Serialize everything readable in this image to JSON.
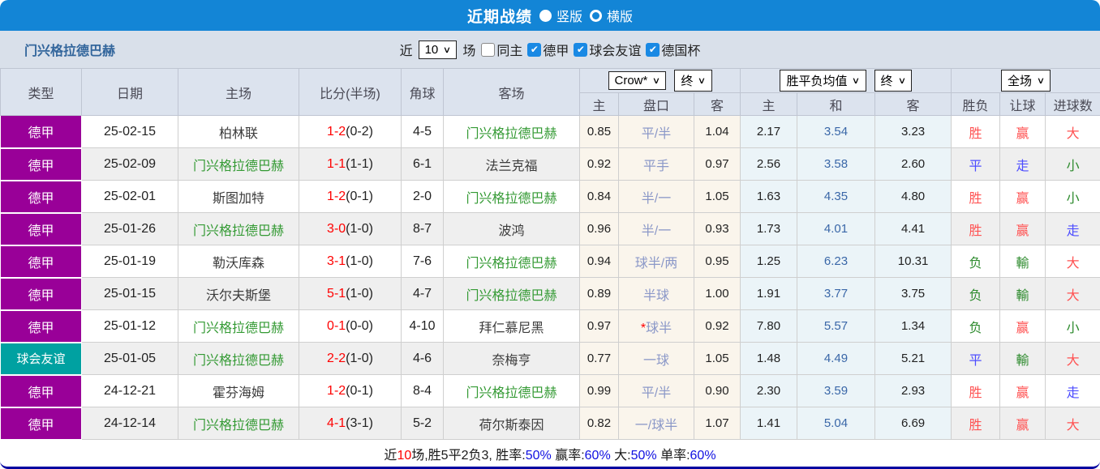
{
  "topbar": {
    "title": "近期战绩",
    "radio_vertical": "竖版",
    "radio_horizontal": "横版"
  },
  "filterbar": {
    "team": "门兴格拉德巴赫",
    "near_label": "近",
    "count_value": "10",
    "games_label": "场",
    "checkboxes": [
      {
        "label": "同主",
        "checked": false
      },
      {
        "label": "德甲",
        "checked": true
      },
      {
        "label": "球会友谊",
        "checked": true
      },
      {
        "label": "德国杯",
        "checked": true
      }
    ]
  },
  "table": {
    "headers_left": [
      "类型",
      "日期",
      "主场",
      "比分(半场)",
      "角球",
      "客场"
    ],
    "dropdowns": {
      "odds_source": "Crow*",
      "odds_time1": "终",
      "avg_type": "胜平负均值",
      "odds_time2": "终",
      "scope": "全场"
    },
    "subheaders": [
      "主",
      "盘口",
      "客",
      "主",
      "和",
      "客",
      "胜负",
      "让球",
      "进球数"
    ],
    "rows": [
      {
        "type": "德甲",
        "type_color": "purple",
        "date": "25-02-15",
        "home": "柏林联",
        "home_focus": false,
        "score": "1-2",
        "half": "(0-2)",
        "corner": "4-5",
        "away": "门兴格拉德巴赫",
        "away_focus": true,
        "odds_home": "0.85",
        "handicap_star": "",
        "handicap": "平/半",
        "odds_away": "1.04",
        "avg_home": "2.17",
        "avg_draw": "3.54",
        "avg_away": "3.23",
        "result": "胜",
        "result_color": "red",
        "handicap_result": "赢",
        "handicap_result_color": "red",
        "goals": "大",
        "goals_color": "red"
      },
      {
        "type": "德甲",
        "type_color": "purple",
        "date": "25-02-09",
        "home": "门兴格拉德巴赫",
        "home_focus": true,
        "score": "1-1",
        "half": "(1-1)",
        "corner": "6-1",
        "away": "法兰克福",
        "away_focus": false,
        "odds_home": "0.92",
        "handicap_star": "",
        "handicap": "平手",
        "odds_away": "0.97",
        "avg_home": "2.56",
        "avg_draw": "3.58",
        "avg_away": "2.60",
        "result": "平",
        "result_color": "blue",
        "handicap_result": "走",
        "handicap_result_color": "blue",
        "goals": "小",
        "goals_color": "green"
      },
      {
        "type": "德甲",
        "type_color": "purple",
        "date": "25-02-01",
        "home": "斯图加特",
        "home_focus": false,
        "score": "1-2",
        "half": "(0-1)",
        "corner": "2-0",
        "away": "门兴格拉德巴赫",
        "away_focus": true,
        "odds_home": "0.84",
        "handicap_star": "",
        "handicap": "半/一",
        "odds_away": "1.05",
        "avg_home": "1.63",
        "avg_draw": "4.35",
        "avg_away": "4.80",
        "result": "胜",
        "result_color": "red",
        "handicap_result": "赢",
        "handicap_result_color": "red",
        "goals": "小",
        "goals_color": "green"
      },
      {
        "type": "德甲",
        "type_color": "purple",
        "date": "25-01-26",
        "home": "门兴格拉德巴赫",
        "home_focus": true,
        "score": "3-0",
        "half": "(1-0)",
        "corner": "8-7",
        "away": "波鸿",
        "away_focus": false,
        "odds_home": "0.96",
        "handicap_star": "",
        "handicap": "半/一",
        "odds_away": "0.93",
        "avg_home": "1.73",
        "avg_draw": "4.01",
        "avg_away": "4.41",
        "result": "胜",
        "result_color": "red",
        "handicap_result": "赢",
        "handicap_result_color": "red",
        "goals": "走",
        "goals_color": "blue"
      },
      {
        "type": "德甲",
        "type_color": "purple",
        "date": "25-01-19",
        "home": "勒沃库森",
        "home_focus": false,
        "score": "3-1",
        "half": "(1-0)",
        "corner": "7-6",
        "away": "门兴格拉德巴赫",
        "away_focus": true,
        "odds_home": "0.94",
        "handicap_star": "",
        "handicap": "球半/两",
        "odds_away": "0.95",
        "avg_home": "1.25",
        "avg_draw": "6.23",
        "avg_away": "10.31",
        "result": "负",
        "result_color": "green",
        "handicap_result": "輸",
        "handicap_result_color": "green",
        "goals": "大",
        "goals_color": "red"
      },
      {
        "type": "德甲",
        "type_color": "purple",
        "date": "25-01-15",
        "home": "沃尔夫斯堡",
        "home_focus": false,
        "score": "5-1",
        "half": "(1-0)",
        "corner": "4-7",
        "away": "门兴格拉德巴赫",
        "away_focus": true,
        "odds_home": "0.89",
        "handicap_star": "",
        "handicap": "半球",
        "odds_away": "1.00",
        "avg_home": "1.91",
        "avg_draw": "3.77",
        "avg_away": "3.75",
        "result": "负",
        "result_color": "green",
        "handicap_result": "輸",
        "handicap_result_color": "green",
        "goals": "大",
        "goals_color": "red"
      },
      {
        "type": "德甲",
        "type_color": "purple",
        "date": "25-01-12",
        "home": "门兴格拉德巴赫",
        "home_focus": true,
        "score": "0-1",
        "half": "(0-0)",
        "corner": "4-10",
        "away": "拜仁慕尼黑",
        "away_focus": false,
        "odds_home": "0.97",
        "handicap_star": "*",
        "handicap": "球半",
        "odds_away": "0.92",
        "avg_home": "7.80",
        "avg_draw": "5.57",
        "avg_away": "1.34",
        "result": "负",
        "result_color": "green",
        "handicap_result": "赢",
        "handicap_result_color": "red",
        "goals": "小",
        "goals_color": "green"
      },
      {
        "type": "球会友谊",
        "type_color": "teal",
        "date": "25-01-05",
        "home": "门兴格拉德巴赫",
        "home_focus": true,
        "score": "2-2",
        "half": "(1-0)",
        "corner": "4-6",
        "away": "奈梅亨",
        "away_focus": false,
        "odds_home": "0.77",
        "handicap_star": "",
        "handicap": "一球",
        "odds_away": "1.05",
        "avg_home": "1.48",
        "avg_draw": "4.49",
        "avg_away": "5.21",
        "result": "平",
        "result_color": "blue",
        "handicap_result": "輸",
        "handicap_result_color": "green",
        "goals": "大",
        "goals_color": "red"
      },
      {
        "type": "德甲",
        "type_color": "purple",
        "date": "24-12-21",
        "home": "霍芬海姆",
        "home_focus": false,
        "score": "1-2",
        "half": "(0-1)",
        "corner": "8-4",
        "away": "门兴格拉德巴赫",
        "away_focus": true,
        "odds_home": "0.99",
        "handicap_star": "",
        "handicap": "平/半",
        "odds_away": "0.90",
        "avg_home": "2.30",
        "avg_draw": "3.59",
        "avg_away": "2.93",
        "result": "胜",
        "result_color": "red",
        "handicap_result": "赢",
        "handicap_result_color": "red",
        "goals": "走",
        "goals_color": "blue"
      },
      {
        "type": "德甲",
        "type_color": "purple",
        "date": "24-12-14",
        "home": "门兴格拉德巴赫",
        "home_focus": true,
        "score": "4-1",
        "half": "(3-1)",
        "corner": "5-2",
        "away": "荷尔斯泰因",
        "away_focus": false,
        "odds_home": "0.82",
        "handicap_star": "",
        "handicap": "一/球半",
        "odds_away": "1.07",
        "avg_home": "1.41",
        "avg_draw": "5.04",
        "avg_away": "6.69",
        "result": "胜",
        "result_color": "red",
        "handicap_result": "赢",
        "handicap_result_color": "red",
        "goals": "大",
        "goals_color": "red"
      }
    ]
  },
  "summary": {
    "segments": [
      {
        "text": "近",
        "color": "black"
      },
      {
        "text": "10",
        "color": "red"
      },
      {
        "text": "场,胜5平2负3, 胜率:",
        "color": "black"
      },
      {
        "text": "50%",
        "color": "blue"
      },
      {
        "text": " 赢率:",
        "color": "black"
      },
      {
        "text": "60%",
        "color": "blue"
      },
      {
        "text": " 大:",
        "color": "black"
      },
      {
        "text": "50%",
        "color": "blue"
      },
      {
        "text": " 单率:",
        "color": "black"
      },
      {
        "text": "60%",
        "color": "blue"
      }
    ]
  },
  "colors": {
    "topbar_blue": "#1385d6",
    "header_bg": "#dce3ee",
    "filter_bg": "#d9e0ea",
    "league_purple": "#990098",
    "friendly_teal": "#00a1a1",
    "focus_team_green": "#349a34",
    "score_red": "#ff0000",
    "win_red": "#ff5252",
    "draw_blue": "#4d4dff",
    "loss_green": "#2e8b2e",
    "avg_draw_blue": "#3a67a8",
    "handicap_slate": "#8b98c8"
  }
}
